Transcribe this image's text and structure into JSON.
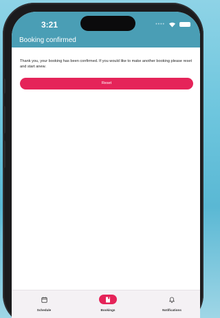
{
  "status_bar": {
    "time": "3:21"
  },
  "header": {
    "title": "Booking confirmed"
  },
  "main": {
    "message": "Thank you, your booking has been confirmed. If you would like to make another booking please reset and start anew.",
    "reset_label": "Reset"
  },
  "tabs": [
    {
      "label": "Schedule",
      "icon": "calendar-icon"
    },
    {
      "label": "Bookings",
      "icon": "bookmark-icon",
      "active": true
    },
    {
      "label": "Notifications",
      "icon": "bell-icon"
    }
  ],
  "colors": {
    "header": "#4a9eb5",
    "accent": "#e52459",
    "tabbar": "#f4f1f4"
  }
}
